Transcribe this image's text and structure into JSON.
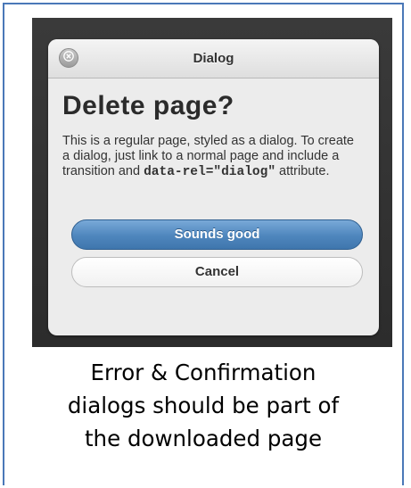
{
  "dialog": {
    "title": "Dialog",
    "heading": "Delete page?",
    "text_part1": "This is a regular page, styled as a dialog. To create a dialog, just link to a normal page and include a transition and ",
    "code_part": "data-rel=\"dialog\"",
    "text_part2": " attribute.",
    "primary_button": "Sounds good",
    "secondary_button": "Cancel"
  },
  "caption": {
    "line1": "Error & Confirmation",
    "line2": "dialogs should be part of",
    "line3": "the downloaded page"
  },
  "colors": {
    "frame_border": "#4a78b8",
    "primary_button": "#4e86bd",
    "screen_background": "#2c2c2c"
  }
}
